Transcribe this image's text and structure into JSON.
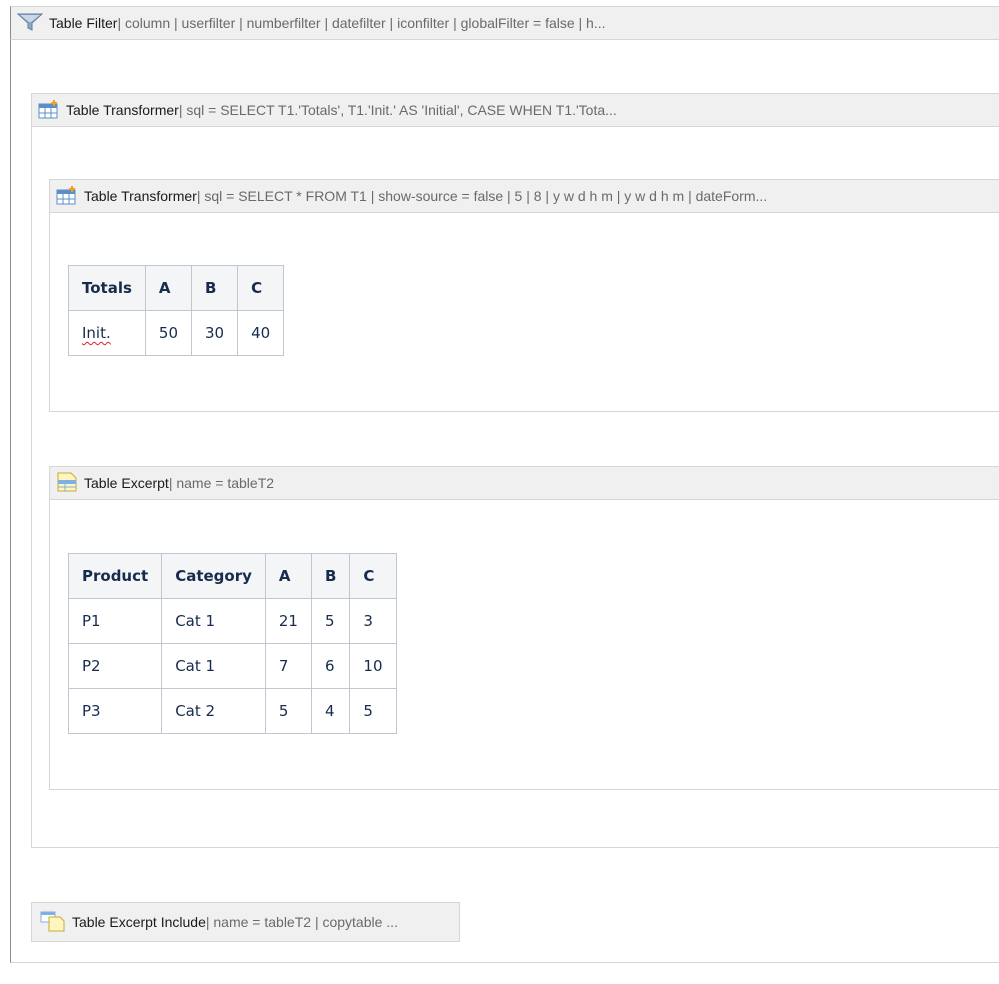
{
  "filter": {
    "title": "Table Filter",
    "params": " | column | userfilter | numberfilter | datefilter | iconfilter | globalFilter = false | h...",
    "icon": "funnel-icon"
  },
  "transformer_outer": {
    "title": "Table Transformer",
    "params": " | sql = SELECT T1.'Totals',    T1.'Init.' AS 'Initial',    CASE        WHEN T1.'Tota...",
    "icon": "table-transformer-icon"
  },
  "transformer_inner": {
    "title": "Table Transformer",
    "params": " | sql = SELECT * FROM T1 | show-source = false | 5 | 8 | y w d h m | y w d h m | dateForm...",
    "icon": "table-transformer-icon",
    "table": {
      "headers": [
        "Totals",
        "A",
        "B",
        "C"
      ],
      "rows": [
        [
          "Init.",
          "50",
          "30",
          "40"
        ]
      ]
    }
  },
  "excerpt": {
    "title": "Table Excerpt",
    "params": " | name = tableT2",
    "icon": "table-excerpt-icon",
    "table": {
      "headers": [
        "Product",
        "Category",
        "A",
        "B",
        "C"
      ],
      "rows": [
        [
          "P1",
          "Cat 1",
          "21",
          "5",
          "3"
        ],
        [
          "P2",
          "Cat 1",
          "7",
          "6",
          "10"
        ],
        [
          "P3",
          "Cat 2",
          "5",
          "4",
          "5"
        ]
      ]
    }
  },
  "excerpt_include": {
    "title": "Table Excerpt Include",
    "params": " | name = tableT2 | copytable ...",
    "icon": "table-excerpt-include-icon"
  },
  "colors": {
    "header_bg": "#f0f0f0",
    "border": "#d6d6d6",
    "table_header_bg": "#f4f5f7",
    "spellcheck_underline": "#e0201f"
  }
}
